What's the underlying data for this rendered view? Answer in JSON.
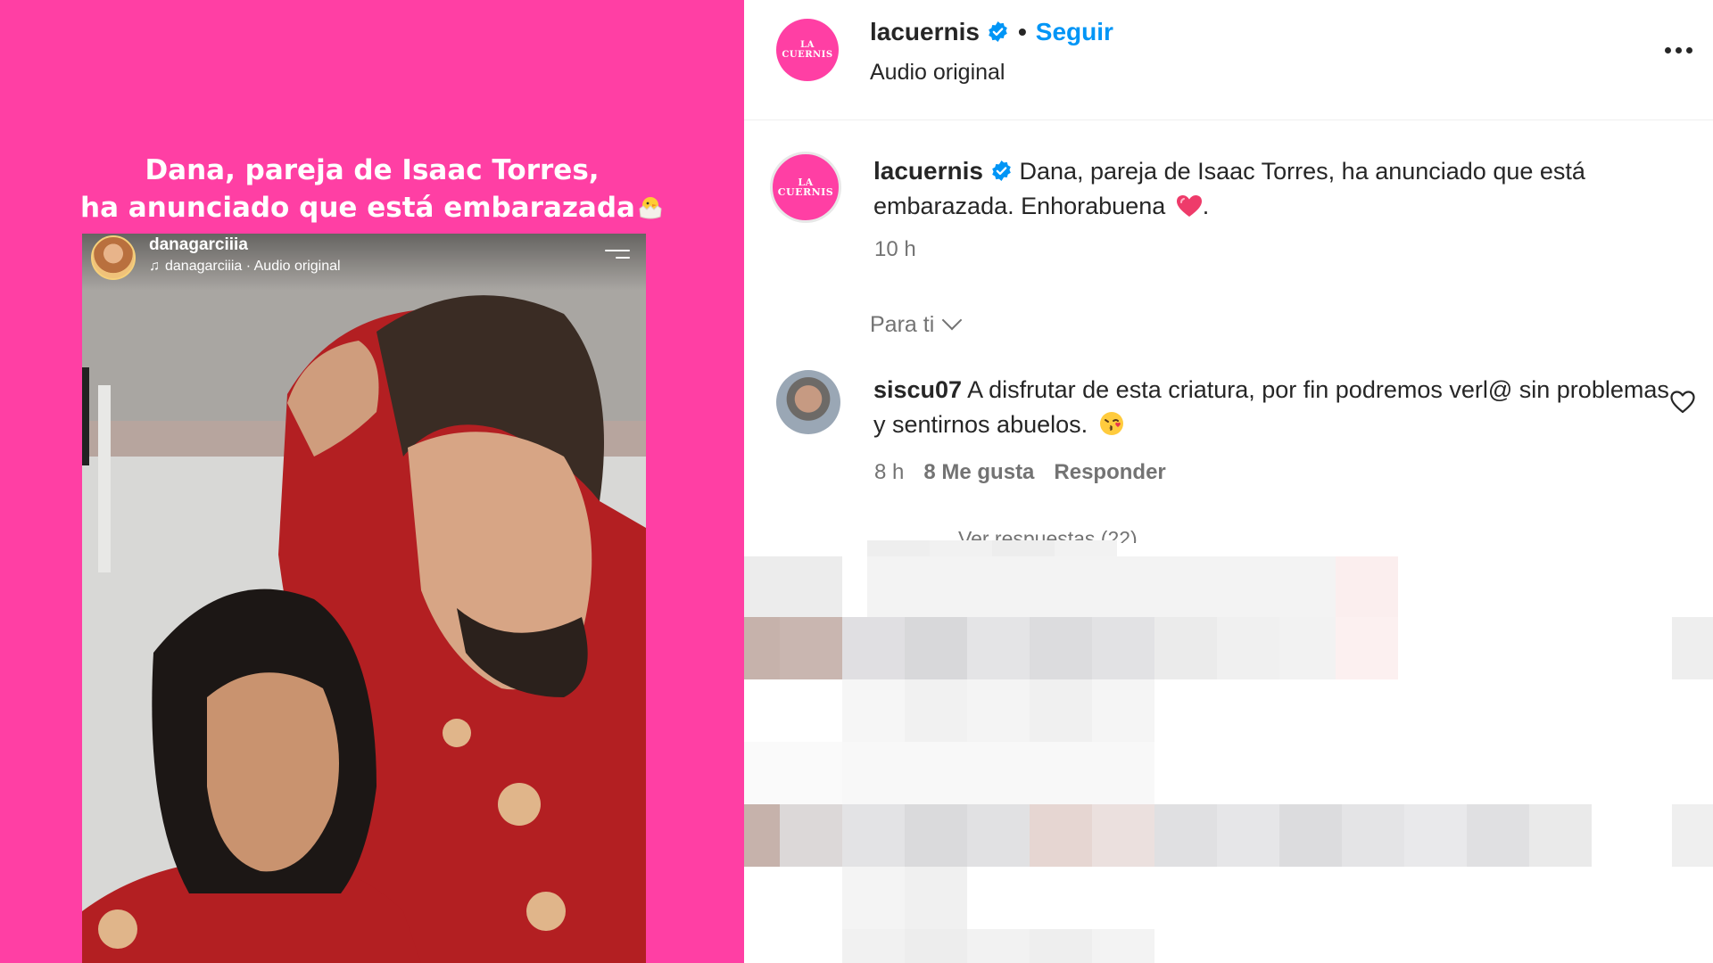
{
  "media": {
    "caption_line1": "Dana, pareja de Isaac Torres,",
    "caption_line2": "ha anunciado que está embarazada",
    "caption_emoji": "hatching-chick-icon",
    "video": {
      "username": "danagarciiia",
      "audio": "danagarciiia · Audio original"
    }
  },
  "post": {
    "author": "lacuernis",
    "author_verified": true,
    "follow_label": "Seguir",
    "separator": "•",
    "audio_label": "Audio original",
    "avatar_logo_line1": "LA",
    "avatar_logo_line2": "CUERNIS"
  },
  "caption": {
    "author": "lacuernis",
    "text": "Dana, pareja de Isaac Torres, ha anunciado que está embarazada. Enhorabuena",
    "emoji": "heart-icon",
    "suffix": ".",
    "time": "10 h"
  },
  "comments_filter": {
    "label": "Para ti"
  },
  "comments": [
    {
      "user": "siscu07",
      "text": "A disfrutar de esta criatura, por fin podremos verl@ sin problemas y sentirnos abuelos.",
      "emoji": "kissing-face-icon",
      "time": "8 h",
      "likes": "8 Me gusta",
      "reply_label": "Responder",
      "view_replies": "Ver respuestas (22)"
    }
  ],
  "colors": {
    "media_background": "#ff3fa4",
    "brand_avatar": "#ff3fa4",
    "follow": "#0095f6",
    "verified": "#0095f6",
    "secondary_text": "#737373"
  }
}
